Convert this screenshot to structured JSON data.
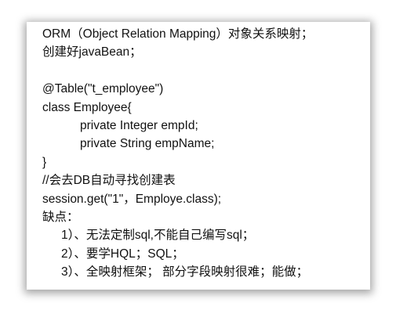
{
  "document": {
    "lines": [
      {
        "text": "ORM（Object Relation Mapping）对象关系映射；",
        "indent": 0
      },
      {
        "text": "创建好javaBean；",
        "indent": 0
      },
      {
        "text": "",
        "indent": 0
      },
      {
        "text": "@Table(\"t_employee\")",
        "indent": 0
      },
      {
        "text": "class Employee{",
        "indent": 0
      },
      {
        "text": "private Integer empId;",
        "indent": 1
      },
      {
        "text": "private String empName;",
        "indent": 1
      },
      {
        "text": "}",
        "indent": 0
      },
      {
        "text": "//会去DB自动寻找创建表",
        "indent": 0
      },
      {
        "text": "session.get(\"1\"，Employe.class);",
        "indent": 0
      },
      {
        "text": "缺点：",
        "indent": 0
      },
      {
        "text": "1）、无法定制sql,不能自己编写sql；",
        "indent": 2
      },
      {
        "text": "2）、要学HQL；SQL；",
        "indent": 2
      },
      {
        "text": "3）、全映射框架； 部分字段映射很难；能做；",
        "indent": 2
      }
    ]
  }
}
